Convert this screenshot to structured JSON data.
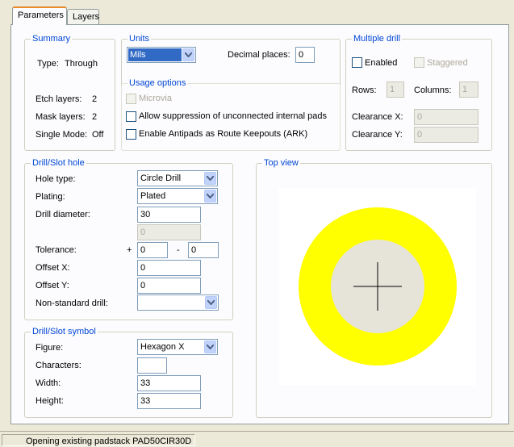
{
  "tabs": [
    "Parameters",
    "Layers"
  ],
  "summary": {
    "title": "Summary",
    "type_label": "Type:",
    "type_value": "Through",
    "etch_label": "Etch layers:",
    "etch_value": "2",
    "mask_label": "Mask layers:",
    "mask_value": "2",
    "single_label": "Single Mode:",
    "single_value": "Off"
  },
  "units": {
    "title": "Units",
    "selected": "Mils",
    "decimal_label": "Decimal places:",
    "decimal_value": "0"
  },
  "usage": {
    "title": "Usage options",
    "microvia": "Microvia",
    "allow_suppression": "Allow suppression of unconnected internal pads",
    "enable_antipads": "Enable Antipads as Route Keepouts (ARK)"
  },
  "multiple_drill": {
    "title": "Multiple drill",
    "enabled": "Enabled",
    "staggered": "Staggered",
    "rows_label": "Rows:",
    "rows_value": "1",
    "columns_label": "Columns:",
    "columns_value": "1",
    "clearance_x_label": "Clearance X:",
    "clearance_x_value": "0",
    "clearance_y_label": "Clearance Y:",
    "clearance_y_value": "0"
  },
  "drill_hole": {
    "title": "Drill/Slot hole",
    "hole_type_label": "Hole type:",
    "hole_type_value": "Circle Drill",
    "plating_label": "Plating:",
    "plating_value": "Plated",
    "diameter_label": "Drill diameter:",
    "diameter_value": "30",
    "diameter2_value": "0",
    "tolerance_label": "Tolerance:",
    "plus_sign": "+",
    "tol_plus": "0",
    "minus_sign": "-",
    "tol_minus": "0",
    "offset_x_label": "Offset X:",
    "offset_x_value": "0",
    "offset_y_label": "Offset Y:",
    "offset_y_value": "0",
    "nonstandard_label": "Non-standard drill:",
    "nonstandard_value": ""
  },
  "drill_symbol": {
    "title": "Drill/Slot symbol",
    "figure_label": "Figure:",
    "figure_value": "Hexagon X",
    "characters_label": "Characters:",
    "characters_value": "",
    "width_label": "Width:",
    "width_value": "33",
    "height_label": "Height:",
    "height_value": "33"
  },
  "top_view": {
    "title": "Top view",
    "pad_color": "#ffff00",
    "hole_color": "#e6e3d8"
  },
  "status_bar": {
    "message": "Opening existing padstack PAD50CIR30D"
  }
}
